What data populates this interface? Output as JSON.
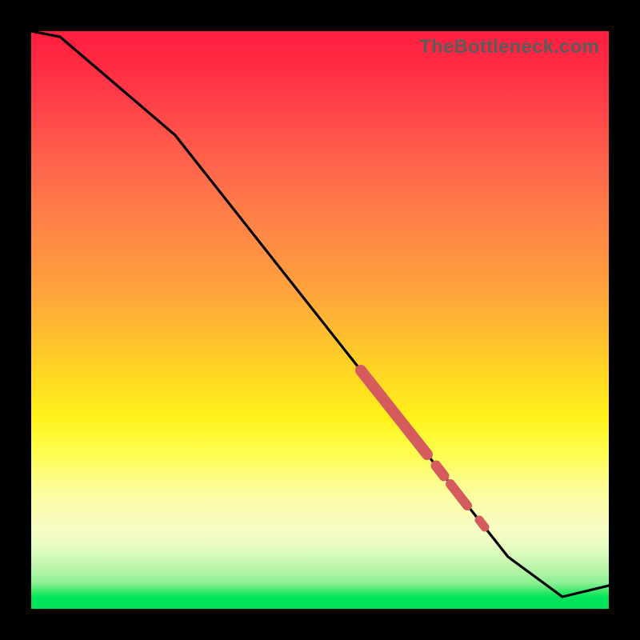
{
  "watermark": "TheBottleneck.com",
  "colors": {
    "curve": "#000000",
    "highlight": "#d55b5d",
    "plot_border": "#000000"
  },
  "chart_data": {
    "type": "line",
    "title": "",
    "xlabel": "",
    "ylabel": "",
    "xlim": [
      0,
      100
    ],
    "ylim": [
      0,
      100
    ],
    "grid": false,
    "series": [
      {
        "name": "curve",
        "x": [
          0,
          5,
          25,
          82.5,
          92,
          100
        ],
        "y": [
          100,
          99,
          82,
          9,
          2,
          4
        ],
        "note": "y values read as percentage height from bottom; curve kinks at x≈25 and flattens at x≈82.5–92"
      }
    ],
    "highlights": [
      {
        "x_start": 57,
        "x_end": 68.5,
        "note": "thick salmon overlay on curve"
      },
      {
        "x_start": 70,
        "x_end": 71.5
      },
      {
        "x_start": 72.5,
        "x_end": 75.5
      },
      {
        "x_start": 77.5,
        "x_end": 78.5
      }
    ]
  }
}
